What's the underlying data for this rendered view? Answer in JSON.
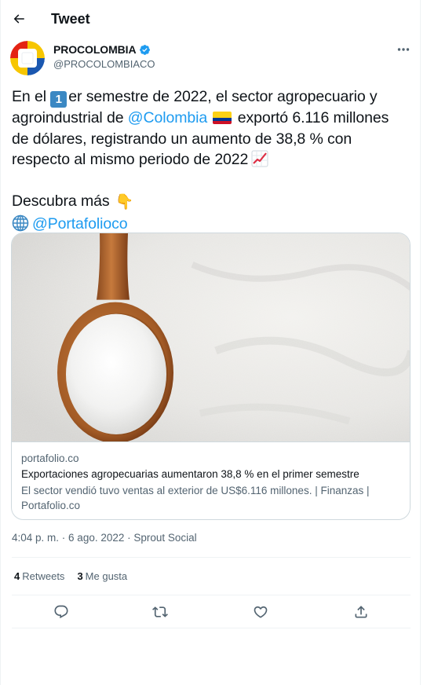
{
  "header": {
    "title": "Tweet",
    "back_icon": "arrow-left-icon"
  },
  "author": {
    "name": "PROCOLOMBIA",
    "handle": "@PROCOLOMBIACO",
    "verified": true,
    "verified_color": "#1d9bf0",
    "avatar_colors": [
      "#e42313",
      "#f7c600",
      "#1a57b0"
    ]
  },
  "tweet": {
    "line1_a": "En el ",
    "line1_num_emoji": "1",
    "line1_b": "er semestre de 2022, el sector agropecuario y",
    "line2_a": "agroindustrial de ",
    "line2_mention": "@Colombia",
    "line2_b": " exportó 6.116 millones",
    "line3": "de dólares, registrando un aumento de 38,8 % con",
    "line4": "respecto al mismo periodo de 2022",
    "line6": "Descubra más",
    "line7_mention": "@Portafolioco",
    "hand_emoji": "👇"
  },
  "card": {
    "domain": "portafolio.co",
    "title": "Exportaciones agropecuarias aumentaron 38,8 % en el primer semestre",
    "description": "El sector vendió tuvo ventas al exterior de US$6.116 millones. | Finanzas | Portafolio.co"
  },
  "meta": {
    "time": "4:04 p. m.",
    "separator1": " · ",
    "date": "6 ago. 2022",
    "separator2": " · ",
    "source": "Sprout Social"
  },
  "stats": {
    "retweets_count": "4",
    "retweets_label": "Retweets",
    "likes_count": "3",
    "likes_label": "Me gusta"
  },
  "actions": [
    "reply-icon",
    "retweet-icon",
    "like-icon",
    "share-icon"
  ],
  "colors": {
    "link": "#1d9bf0",
    "secondary_text": "#536471",
    "border": "#cfd9de"
  }
}
